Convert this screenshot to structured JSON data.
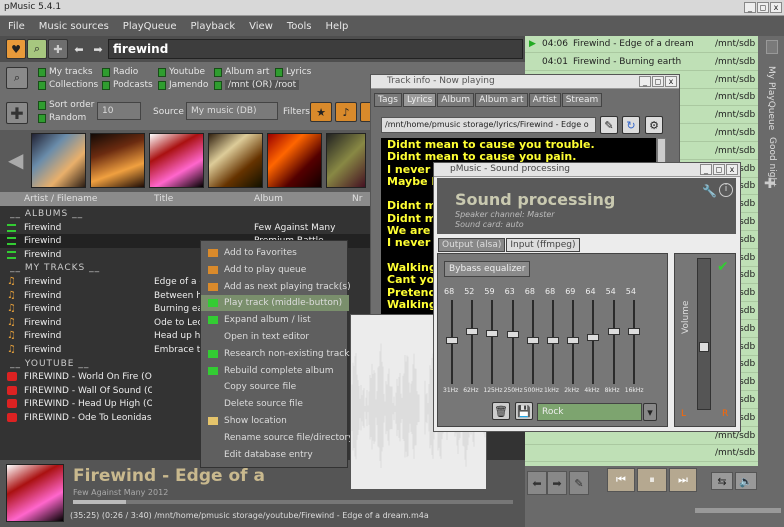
{
  "app_title": "pMusic 5.4.1",
  "window_controls": [
    "_",
    "◻",
    "x"
  ],
  "menu": [
    "File",
    "Music sources",
    "PlayQueue",
    "Playback",
    "View",
    "Tools",
    "Help"
  ],
  "search_value": "firewind",
  "source_filters": {
    "my_tracks": "My tracks",
    "collections": "Collections",
    "radio": "Radio",
    "podcasts": "Podcasts",
    "youtube": "Youtube",
    "jamendo": "Jamendo",
    "album_art": "Album art",
    "path": "/mnt (OR) /root",
    "lyrics": "Lyrics"
  },
  "sort_order": "Sort order",
  "random": "Random",
  "count_value": "10",
  "source_label": "Source",
  "source_value": "My music (DB)",
  "filters_label": "Filters",
  "columns": {
    "artist": "Artist / Filename",
    "title": "Title",
    "album": "Album",
    "nr": "Nr"
  },
  "rows": [
    {
      "type": "section",
      "text": "__ ALBUMS __"
    },
    {
      "type": "list",
      "artist": "Firewind",
      "title": "",
      "album": "Few Against Many"
    },
    {
      "type": "list",
      "artist": "Firewind",
      "title": "",
      "album": "Premium Battle",
      "selected": true
    },
    {
      "type": "list",
      "artist": "Firewind",
      "title": "",
      "album": ""
    },
    {
      "type": "section",
      "text": "__ MY TRACKS __"
    },
    {
      "type": "note",
      "artist": "Firewind",
      "title": "Edge of a d",
      "album": ""
    },
    {
      "type": "note",
      "artist": "Firewind",
      "title": "Between h",
      "album": ""
    },
    {
      "type": "note",
      "artist": "Firewind",
      "title": "Burning ea",
      "album": ""
    },
    {
      "type": "note",
      "artist": "Firewind",
      "title": "Ode to Lec",
      "album": ""
    },
    {
      "type": "note",
      "artist": "Firewind",
      "title": "Head up h",
      "album": ""
    },
    {
      "type": "note",
      "artist": "Firewind",
      "title": "Embrace t",
      "album": ""
    },
    {
      "type": "section",
      "text": "__ YOUTUBE __"
    },
    {
      "type": "yt",
      "artist": "FIREWIND - World On Fire (OFFIC",
      "title": "",
      "album": ""
    },
    {
      "type": "yt",
      "artist": "FIREWIND - Wall Of Sound (OFFI",
      "title": "",
      "album": ""
    },
    {
      "type": "yt",
      "artist": "FIREWIND - Head Up High (OFFI",
      "title": "",
      "album": ""
    },
    {
      "type": "yt",
      "artist": "FIREWIND - Ode To Leonidas (O",
      "title": "",
      "album": ""
    }
  ],
  "now_playing": {
    "title": "Firewind - Edge of a",
    "sub": "Few Against Many 2012",
    "status": "(35:25)    (0:26 / 3:40) /mnt/home/pmusic storage/youtube/Firewind  -  Edge of a dream.m4a"
  },
  "queue": [
    {
      "time": "04:06",
      "title": "Firewind - Edge of a dream",
      "path": "/mnt/sdb",
      "playing": true
    },
    {
      "time": "04:01",
      "title": "Firewind - Burning earth",
      "path": "/mnt/sdb"
    },
    {
      "time": "",
      "title": "",
      "path": "/mnt/sdb"
    },
    {
      "time": "",
      "title": "",
      "path": "/mnt/sdb"
    },
    {
      "time": "",
      "title": "",
      "path": "/mnt/sdb"
    },
    {
      "time": "",
      "title": "",
      "path": "/mnt/sdb"
    },
    {
      "time": "",
      "title": "",
      "path": "/mnt/sdb"
    },
    {
      "time": "",
      "title": "",
      "path": "/mnt/sdb"
    },
    {
      "time": "",
      "title": "",
      "path": "/mnt/sdb"
    },
    {
      "time": "",
      "title": "",
      "path": "/mnt/sdb"
    },
    {
      "time": "",
      "title": "",
      "path": "/mnt/sdb"
    },
    {
      "time": "",
      "title": "",
      "path": "/mnt/sdb"
    },
    {
      "time": "",
      "title": "",
      "path": "/mnt/sdb"
    },
    {
      "time": "",
      "title": "",
      "path": "/mnt/sdb"
    },
    {
      "time": "",
      "title": "",
      "path": "/mnt/sdb"
    },
    {
      "time": "",
      "title": "",
      "path": "/mnt/sdb"
    },
    {
      "time": "",
      "title": "",
      "path": "/mnt/sdb"
    },
    {
      "time": "",
      "title": "",
      "path": "/mnt/sdb"
    },
    {
      "time": "",
      "title": "",
      "path": "/mnt/sdb"
    },
    {
      "time": "",
      "title": "",
      "path": "/mnt/sdb"
    },
    {
      "time": "",
      "title": "",
      "path": "/mnt/sdb"
    },
    {
      "time": "",
      "title": "",
      "path": "/mnt/sdb"
    },
    {
      "time": "",
      "title": "",
      "path": "/mnt/sdb"
    },
    {
      "time": "",
      "title": "",
      "path": "/mnt/sdb"
    }
  ],
  "side_tabs": {
    "playqueue": "My PlayQueue",
    "goodnight": "Good night"
  },
  "track_info": {
    "title": "Track info - Now playing",
    "tabs": [
      "Tags",
      "Lyrics",
      "Album",
      "Album art",
      "Artist",
      "Stream"
    ],
    "active_tab": "Lyrics",
    "path": "/mnt/home/pmusic storage/lyrics/Firewind - Edge o",
    "lyrics": [
      "Didnt mean to cause you trouble.",
      "Didnt mean to cause you pain.",
      "I never",
      "Maybe I",
      "",
      "Didnt m",
      "Didnt m",
      "We are",
      "I never",
      "",
      "Walking",
      "Cant yo",
      "Pretend",
      "Walking"
    ]
  },
  "context_menu": [
    {
      "label": "Add to Favorites",
      "icon": "plus"
    },
    {
      "label": "Add to play queue",
      "icon": "plus"
    },
    {
      "label": "Add as next playing track(s)",
      "icon": "plus"
    },
    {
      "label": "Play track (middle-button)",
      "icon": "play",
      "highlight": true
    },
    {
      "label": "Expand album / list",
      "icon": "list"
    },
    {
      "label": "Open in text editor",
      "icon": ""
    },
    {
      "label": "Research non-existing tracks",
      "icon": "filter"
    },
    {
      "label": "Rebuild complete album",
      "icon": "list"
    },
    {
      "label": "Copy source file",
      "icon": ""
    },
    {
      "label": "Delete source file",
      "icon": ""
    },
    {
      "label": "Show location",
      "icon": "folder"
    },
    {
      "label": "Rename source file/directory",
      "icon": ""
    },
    {
      "label": "Edit database entry",
      "icon": ""
    }
  ],
  "sound": {
    "window_title": "pMusic - Sound processing",
    "heading": "Sound processing",
    "speaker": "Speaker channel: Master",
    "soundcard": "Sound card: auto",
    "tabs": [
      "Output (alsa)",
      "Input (ffmpeg)"
    ],
    "bypass": "Bybass equalizer",
    "levels": [
      "68",
      "52",
      "59",
      "63",
      "68",
      "68",
      "69",
      "64",
      "54",
      "54"
    ],
    "bands": [
      "31Hz",
      "62Hz",
      "125Hz",
      "250Hz",
      "500Hz",
      "1kHz",
      "2kHz",
      "4kHz",
      "8kHz",
      "16kHz"
    ],
    "band_level": [
      0.47,
      0.36,
      0.38,
      0.4,
      0.47,
      0.47,
      0.48,
      0.44,
      0.36,
      0.36
    ],
    "preset": "Rock",
    "volume_label": "Volume",
    "left": "L",
    "right": "R"
  },
  "colors": {
    "accent_green": "#2f9d2f",
    "queue_bg": "#bfe0b6",
    "lyrics_text": "#ffff33",
    "yt_red": "#dd2222",
    "note_orange": "#e9a23b"
  }
}
